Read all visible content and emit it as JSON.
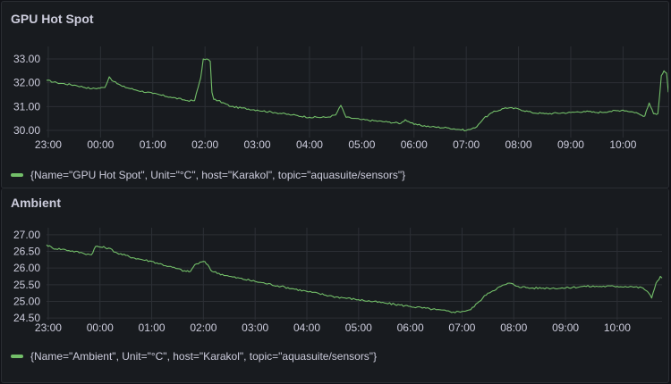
{
  "colors": {
    "background": "#111217",
    "panel": "#181b1f",
    "grid": "#2c2f35",
    "text": "#ccccdc",
    "series": "#73bf69"
  },
  "chart_data": [
    {
      "type": "line",
      "title": "GPU Hot Spot",
      "xlabel": "",
      "ylabel": "",
      "x_ticks": [
        "23:00",
        "00:00",
        "01:00",
        "02:00",
        "03:00",
        "04:00",
        "05:00",
        "06:00",
        "07:00",
        "08:00",
        "09:00",
        "10:00"
      ],
      "y_ticks": [
        "30.00",
        "31.00",
        "32.00",
        "33.00"
      ],
      "xlim": [
        "22:58",
        "10:52"
      ],
      "ylim": [
        29.7,
        33.3
      ],
      "grid": true,
      "legend_position": "bottom-left",
      "series": [
        {
          "name": "{Name=\"GPU Hot Spot\", Unit=\"°C\", host=\"Karakol\", topic=\"aquasuite/sensors\"}",
          "color": "#73bf69",
          "x": [
            "22:58",
            "23:10",
            "23:30",
            "23:50",
            "00:05",
            "00:10",
            "00:15",
            "00:25",
            "00:40",
            "01:00",
            "01:20",
            "01:40",
            "01:48",
            "01:52",
            "01:55",
            "01:58",
            "02:02",
            "02:06",
            "02:08",
            "02:10",
            "02:15",
            "02:30",
            "03:00",
            "03:20",
            "03:40",
            "04:00",
            "04:20",
            "04:30",
            "04:36",
            "04:42",
            "05:00",
            "05:30",
            "05:45",
            "05:50",
            "06:00",
            "06:20",
            "06:40",
            "07:00",
            "07:10",
            "07:20",
            "07:30",
            "07:45",
            "08:00",
            "08:15",
            "08:30",
            "09:00",
            "09:15",
            "09:30",
            "09:45",
            "10:00",
            "10:15",
            "10:20",
            "10:25",
            "10:30",
            "10:35",
            "10:40",
            "10:44",
            "10:47",
            "10:50",
            "10:52"
          ],
          "values": [
            32.1,
            32.0,
            31.9,
            31.75,
            31.8,
            32.25,
            32.05,
            31.85,
            31.7,
            31.55,
            31.4,
            31.25,
            31.25,
            31.8,
            32.2,
            33.0,
            33.0,
            32.9,
            31.6,
            31.3,
            31.25,
            31.0,
            30.85,
            30.75,
            30.65,
            30.55,
            30.55,
            30.65,
            31.05,
            30.55,
            30.45,
            30.35,
            30.3,
            30.45,
            30.25,
            30.15,
            30.1,
            30.0,
            30.1,
            30.5,
            30.75,
            30.95,
            30.9,
            30.75,
            30.7,
            30.75,
            30.8,
            30.75,
            30.8,
            30.85,
            30.75,
            30.65,
            30.6,
            31.15,
            30.7,
            30.7,
            32.3,
            32.5,
            32.4,
            31.6
          ]
        }
      ]
    },
    {
      "type": "line",
      "title": "Ambient",
      "xlabel": "",
      "ylabel": "",
      "x_ticks": [
        "23:00",
        "00:00",
        "01:00",
        "02:00",
        "03:00",
        "04:00",
        "05:00",
        "06:00",
        "07:00",
        "08:00",
        "09:00",
        "10:00"
      ],
      "y_ticks": [
        "24.50",
        "25.00",
        "25.50",
        "26.00",
        "26.50",
        "27.00"
      ],
      "xlim": [
        "22:58",
        "10:52"
      ],
      "ylim": [
        24.45,
        27.05
      ],
      "grid": true,
      "legend_position": "bottom-left",
      "series": [
        {
          "name": "{Name=\"Ambient\", Unit=\"°C\", host=\"Karakol\", topic=\"aquasuite/sensors\"}",
          "color": "#73bf69",
          "x": [
            "22:58",
            "23:05",
            "23:20",
            "23:40",
            "23:50",
            "23:55",
            "00:10",
            "00:20",
            "00:40",
            "01:00",
            "01:20",
            "01:40",
            "01:45",
            "01:50",
            "02:00",
            "02:05",
            "02:10",
            "02:30",
            "03:00",
            "03:30",
            "04:00",
            "04:30",
            "05:00",
            "05:30",
            "06:00",
            "06:30",
            "06:50",
            "07:00",
            "07:10",
            "07:20",
            "07:30",
            "07:45",
            "07:55",
            "08:05",
            "08:20",
            "08:40",
            "09:00",
            "09:20",
            "09:40",
            "10:00",
            "10:15",
            "10:30",
            "10:35",
            "10:40",
            "10:45",
            "10:50",
            "10:52"
          ],
          "values": [
            26.7,
            26.6,
            26.55,
            26.45,
            26.4,
            26.65,
            26.6,
            26.45,
            26.3,
            26.2,
            26.05,
            25.9,
            25.9,
            26.1,
            26.2,
            26.1,
            25.9,
            25.75,
            25.6,
            25.45,
            25.3,
            25.15,
            25.05,
            24.95,
            24.85,
            24.75,
            24.68,
            24.7,
            24.75,
            25.0,
            25.25,
            25.45,
            25.55,
            25.45,
            25.4,
            25.4,
            25.4,
            25.45,
            25.45,
            25.45,
            25.45,
            25.4,
            25.3,
            25.1,
            25.55,
            25.75,
            25.7
          ]
        }
      ]
    }
  ]
}
